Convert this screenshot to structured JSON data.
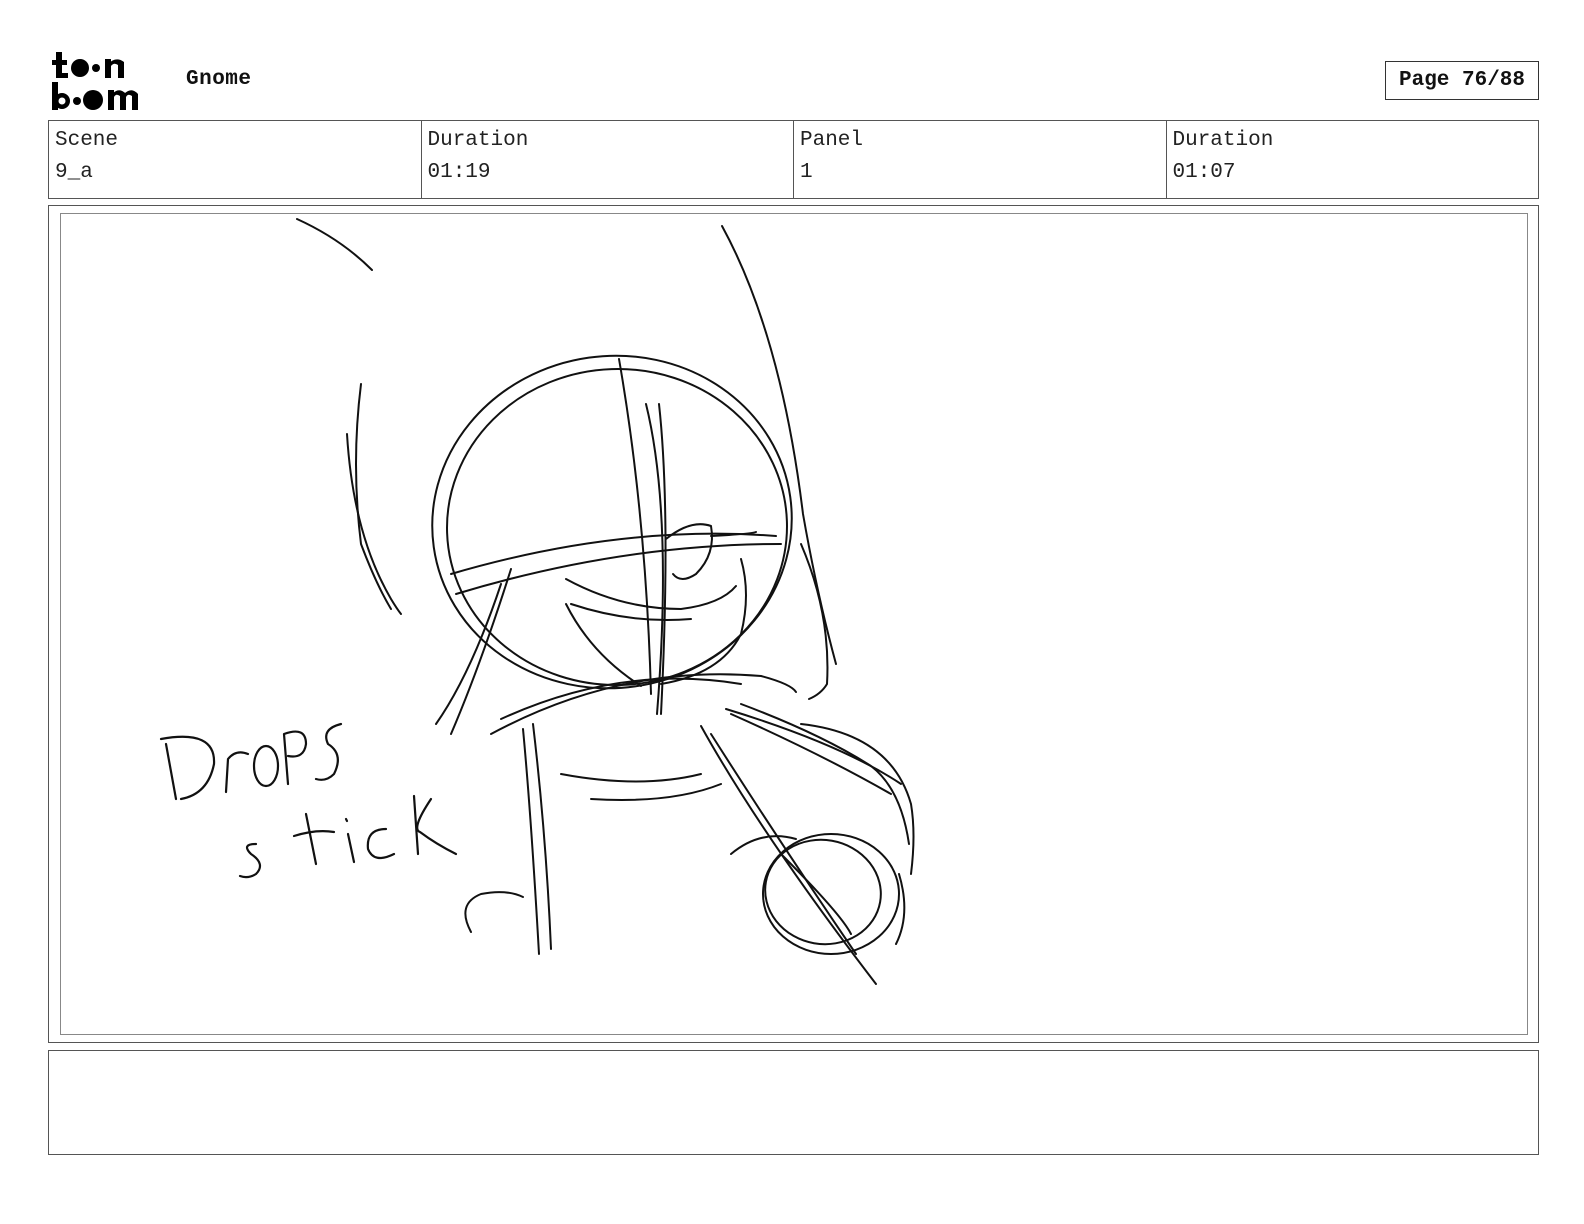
{
  "brand": {
    "logo_text_top": "toon",
    "logo_text_bottom": "boom"
  },
  "header": {
    "project_title": "Gnome",
    "page_label": "Page 76/88"
  },
  "info": [
    {
      "label": "Scene",
      "value": "9_a"
    },
    {
      "label": "Duration",
      "value": "01:19"
    },
    {
      "label": "Panel",
      "value": "1"
    },
    {
      "label": "Duration",
      "value": "01:07"
    }
  ],
  "panel": {
    "sketch_note_line1": "Drops",
    "sketch_note_line2": "stick"
  },
  "caption": {
    "text": ""
  }
}
